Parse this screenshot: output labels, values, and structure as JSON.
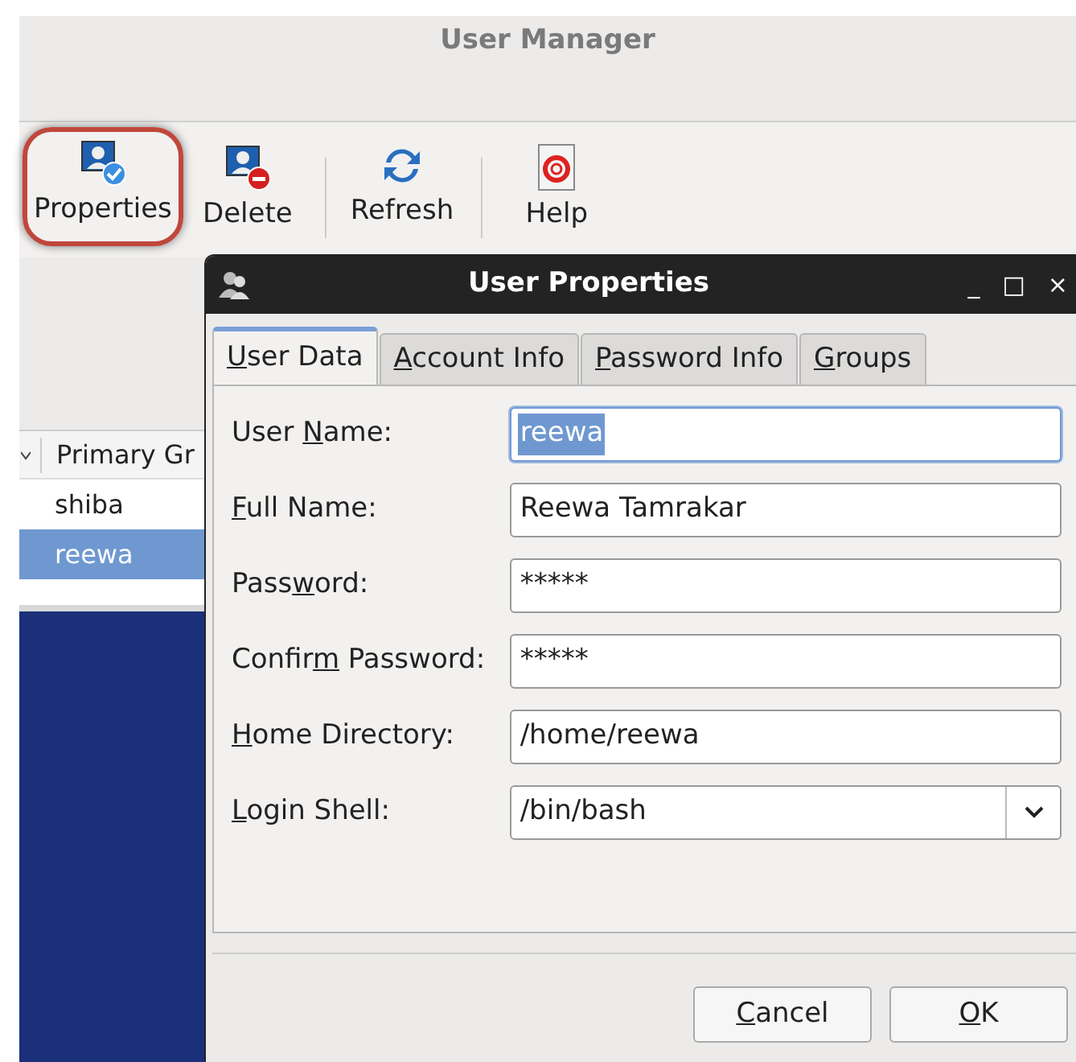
{
  "main_window": {
    "title": "User Manager",
    "toolbar": [
      {
        "kind": "properties",
        "label": "Properties",
        "highlighted": true
      },
      {
        "kind": "delete",
        "label": "Delete",
        "highlighted": false
      },
      {
        "kind": "refresh",
        "label": "Refresh",
        "highlighted": false
      },
      {
        "kind": "help",
        "label": "Help",
        "highlighted": false
      }
    ],
    "table": {
      "columns": [
        "Primary Gr"
      ],
      "rows": [
        {
          "cells": [
            "shiba"
          ],
          "selected": false
        },
        {
          "cells": [
            "reewa"
          ],
          "selected": true
        }
      ]
    }
  },
  "dialog": {
    "title": "User Properties",
    "controls": [
      "_",
      "□",
      "×"
    ],
    "tabs": [
      {
        "key": "U",
        "after": "ser Data",
        "selected": true
      },
      {
        "key": "A",
        "after": "ccount Info",
        "selected": false
      },
      {
        "key": "P",
        "after": "assword Info",
        "selected": false
      },
      {
        "key": "G",
        "after": "roups",
        "selected": false
      }
    ],
    "fields": [
      {
        "kind": "text",
        "before": "User ",
        "key": "N",
        "after": "ame:",
        "value": "reewa",
        "selected_text": true
      },
      {
        "kind": "text",
        "key": "F",
        "after": "ull Name:",
        "value": "Reewa Tamrakar",
        "selected_text": false
      },
      {
        "kind": "text",
        "before": "Pass",
        "key": "w",
        "after": "ord:",
        "value": "*****",
        "selected_text": false
      },
      {
        "kind": "text",
        "before": "Confir",
        "key": "m",
        "after": " Password:",
        "value": "*****",
        "selected_text": false
      },
      {
        "kind": "text",
        "key": "H",
        "after": "ome Directory:",
        "value": "/home/reewa",
        "selected_text": false
      },
      {
        "kind": "combo",
        "key": "L",
        "after": "ogin Shell:",
        "value": "/bin/bash"
      }
    ],
    "buttons": [
      {
        "key": "C",
        "after": "ancel"
      },
      {
        "key": "O",
        "after": "K"
      }
    ]
  }
}
